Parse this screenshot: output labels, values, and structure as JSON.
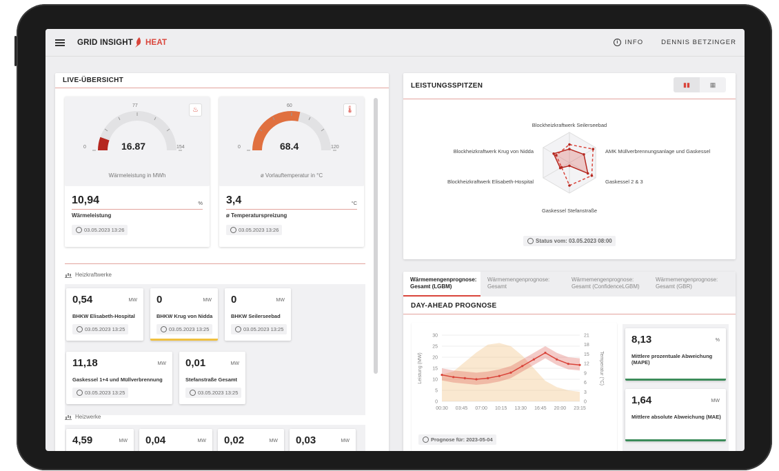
{
  "header": {
    "brand": "GRID INSIGHT",
    "brand_accent": "HEAT",
    "info": "INFO",
    "user": "DENNIS BETZINGER"
  },
  "live": {
    "title": "LIVE-ÜBERSICHT",
    "gauges": [
      {
        "value": "16.87",
        "min": "0",
        "max": "154",
        "mid": "77",
        "label": "Wärmeleistung in MWh",
        "fraction": 0.11,
        "icon": "heat-waves-icon",
        "color": "#b5271f"
      },
      {
        "value": "68.4",
        "min": "0",
        "max": "120",
        "mid": "60",
        "label": "ø Vorlauftemperatur in °C",
        "fraction": 0.57,
        "icon": "thermometer-icon",
        "color": "#e0703f"
      }
    ],
    "kpis": [
      {
        "value": "10,94",
        "unit": "%",
        "label": "Wärmeleistung",
        "time": "03.05.2023 13:26"
      },
      {
        "value": "3,4",
        "unit": "°C",
        "label": "ø Temperaturspreizung",
        "time": "03.05.2023 13:26"
      }
    ],
    "heizkraftwerke": {
      "title": "Heizkraftwerke",
      "items": [
        {
          "value": "0,54",
          "unit": "MW",
          "name": "BHKW Elisabeth-Hospital",
          "time": "03.05.2023 13:25"
        },
        {
          "value": "0",
          "unit": "MW",
          "name": "BHKW Krug von Nidda",
          "time": "03.05.2023 13:25"
        },
        {
          "value": "0",
          "unit": "MW",
          "name": "BHKW Seilerseebad",
          "time": "03.05.2023 13:25"
        },
        {
          "value": "11,18",
          "unit": "MW",
          "name": "Gaskessel 1+4 und Müllverbrennung",
          "time": "03.05.2023 13:25"
        },
        {
          "value": "0,01",
          "unit": "MW",
          "name": "Stefanstraße Gesamt",
          "time": "03.05.2023 13:25"
        }
      ]
    },
    "heizwerke": {
      "title": "Heizwerke",
      "items": [
        {
          "value": "4,59",
          "unit": "MW"
        },
        {
          "value": "0,04",
          "unit": "MW"
        },
        {
          "value": "0,02",
          "unit": "MW"
        },
        {
          "value": "0,03",
          "unit": "MW"
        }
      ]
    }
  },
  "peaks": {
    "title": "LEISTUNGSSPITZEN",
    "status": "Status vom: 03.05.2023 08:00",
    "labels": [
      "Blockheizkraftwerk Seilerseebad",
      "AMK Müllverbrennungsanlage und Gaskessel",
      "Gaskessel 2 & 3",
      "Gaskessel Stefanstraße",
      "Blockheizkraftwerk Elisabeth-Hospital",
      "Blockheizkraftwerk Krug von Nidda"
    ]
  },
  "forecast": {
    "tabs": [
      {
        "l1": "Wärmemengenprognose:",
        "l2": "Gesamt (LGBM)"
      },
      {
        "l1": "Wärmemengenprognose:",
        "l2": "Gesamt"
      },
      {
        "l1": "Wärmemengenprognose:",
        "l2": "Gesamt (ConfidenceLGBM)"
      },
      {
        "l1": "Wärmemengenprognose:",
        "l2": "Gesamt (GBR)"
      }
    ],
    "title": "DAY-AHEAD PROGNOSE",
    "prog_for": "Prognose für: 2023-05-04",
    "metrics": [
      {
        "value": "8,13",
        "unit": "%",
        "label": "Mittlere prozentuale Abweichung (MAPE)"
      },
      {
        "value": "1,64",
        "unit": "MW",
        "label": "Mittlere absolute Abweichung (MAE)"
      }
    ]
  },
  "chart_data": [
    {
      "type": "line",
      "x": [
        "00:30",
        "03:45",
        "07:00",
        "10:15",
        "13:30",
        "16:45",
        "20:00",
        "23:15"
      ],
      "ylabel": "Leistung (MW)",
      "ylabel_right": "Temperatur (°C)",
      "ylim": [
        0,
        30
      ],
      "ylim_right": [
        0,
        21
      ],
      "yticks": [
        0,
        5,
        10,
        15,
        20,
        25,
        30
      ],
      "yticks_right": [
        0,
        3,
        6,
        9,
        12,
        15,
        18,
        21
      ],
      "series": [
        {
          "values": [
            12,
            11,
            10.5,
            10,
            10.5,
            11.5,
            13,
            16,
            19,
            22,
            19,
            17,
            16.5
          ]
        },
        {
          "values": [
            7,
            8,
            11,
            14,
            16.5,
            17,
            16,
            13,
            9,
            5,
            3,
            2,
            1.5
          ]
        }
      ]
    },
    {
      "type": "radar",
      "categories": [
        "Blockheizkraftwerk Seilerseebad",
        "AMK Müllverbrennungsanlage und Gaskessel",
        "Gaskessel 2 & 3",
        "Gaskessel Stefanstraße",
        "Blockheizkraftwerk Elisabeth-Hospital",
        "Blockheizkraftwerk Krug von Nidda"
      ],
      "series": [
        {
          "values": [
            0.45,
            0.55,
            0.7,
            0.1,
            0.35,
            0.6
          ]
        },
        {
          "values": [
            0.6,
            0.9,
            0.85,
            0.75,
            0.3,
            0.5
          ]
        }
      ]
    }
  ],
  "colors": {
    "accent": "#d9443a",
    "ok": "#3c8c5a",
    "warn": "#f0c040"
  }
}
